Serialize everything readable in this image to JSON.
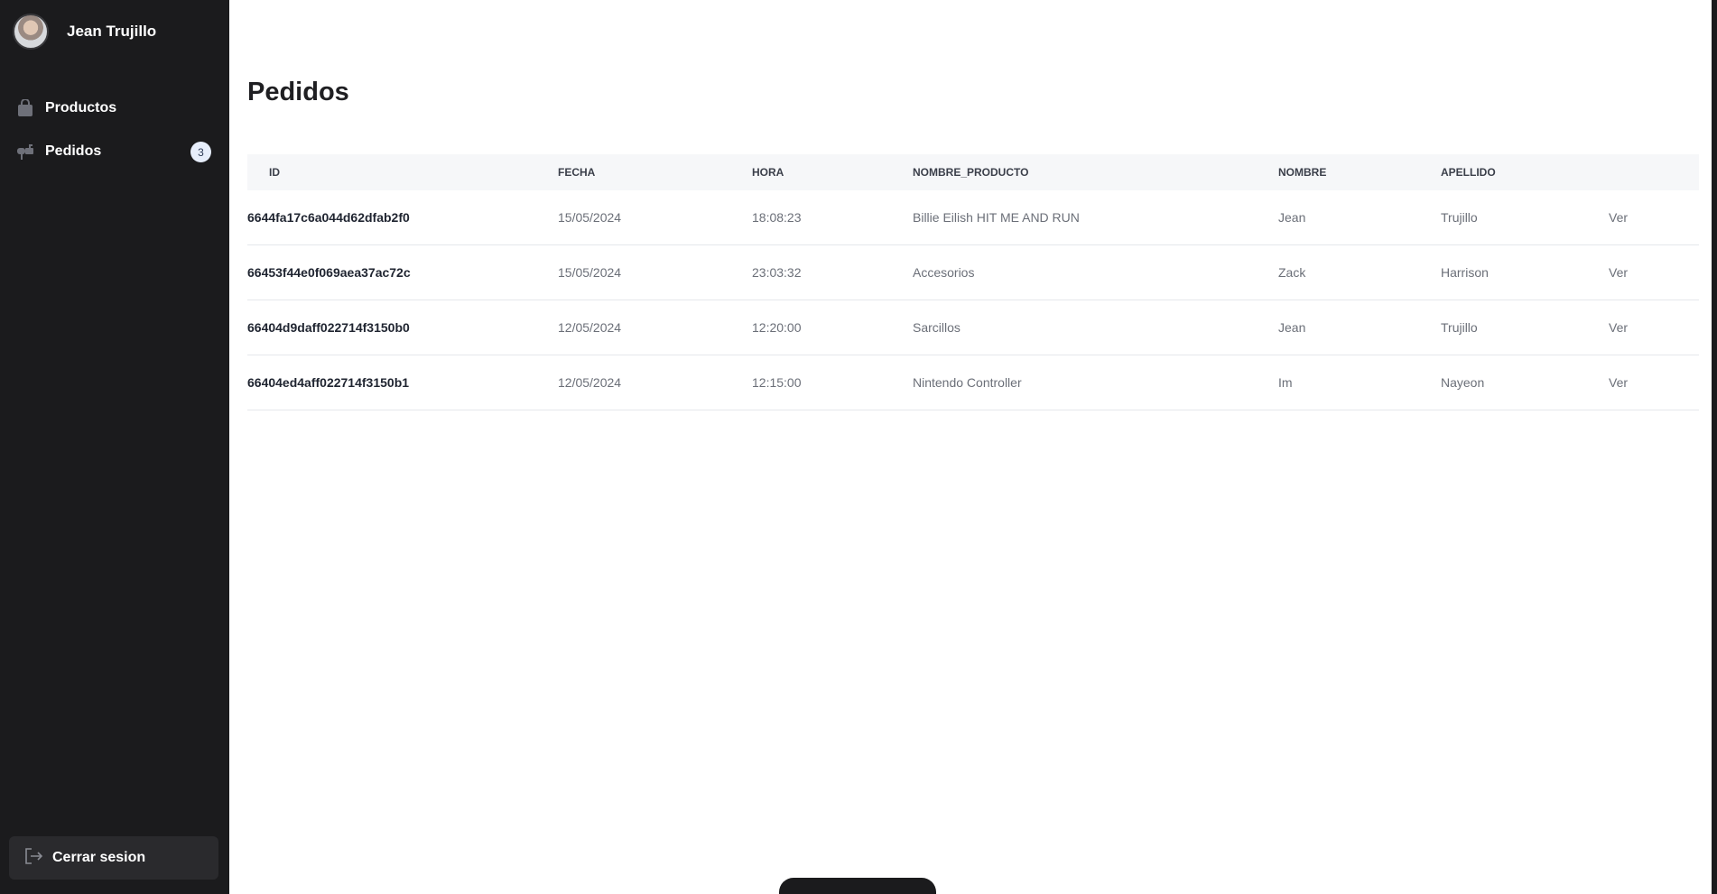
{
  "sidebar": {
    "user_name": "Jean Trujillo",
    "items": [
      {
        "label": "Productos",
        "icon": "shopping-bag-icon"
      },
      {
        "label": "Pedidos",
        "icon": "mailbox-icon",
        "badge": "3"
      }
    ],
    "logout_label": "Cerrar sesion"
  },
  "main": {
    "title": "Pedidos",
    "table": {
      "headers": [
        "ID",
        "FECHA",
        "HORA",
        "NOMBRE_PRODUCTO",
        "NOMBRE",
        "APELLIDO"
      ],
      "rows": [
        {
          "id": "6644fa17c6a044d62dfab2f0",
          "fecha": "15/05/2024",
          "hora": "18:08:23",
          "producto": "Billie Eilish HIT ME AND RUN",
          "nombre": "Jean",
          "apellido": "Trujillo",
          "action": "Ver"
        },
        {
          "id": "66453f44e0f069aea37ac72c",
          "fecha": "15/05/2024",
          "hora": "23:03:32",
          "producto": "Accesorios",
          "nombre": "Zack",
          "apellido": "Harrison",
          "action": "Ver"
        },
        {
          "id": "66404d9daff022714f3150b0",
          "fecha": "12/05/2024",
          "hora": "12:20:00",
          "producto": "Sarcillos",
          "nombre": "Jean",
          "apellido": "Trujillo",
          "action": "Ver"
        },
        {
          "id": "66404ed4aff022714f3150b1",
          "fecha": "12/05/2024",
          "hora": "12:15:00",
          "producto": "Nintendo Controller",
          "nombre": "Im",
          "apellido": "Nayeon",
          "action": "Ver"
        }
      ]
    }
  },
  "colors": {
    "sidebar_bg": "#1b1b1d",
    "badge_bg": "#e7eefb",
    "header_bg": "#f6f7f9"
  }
}
